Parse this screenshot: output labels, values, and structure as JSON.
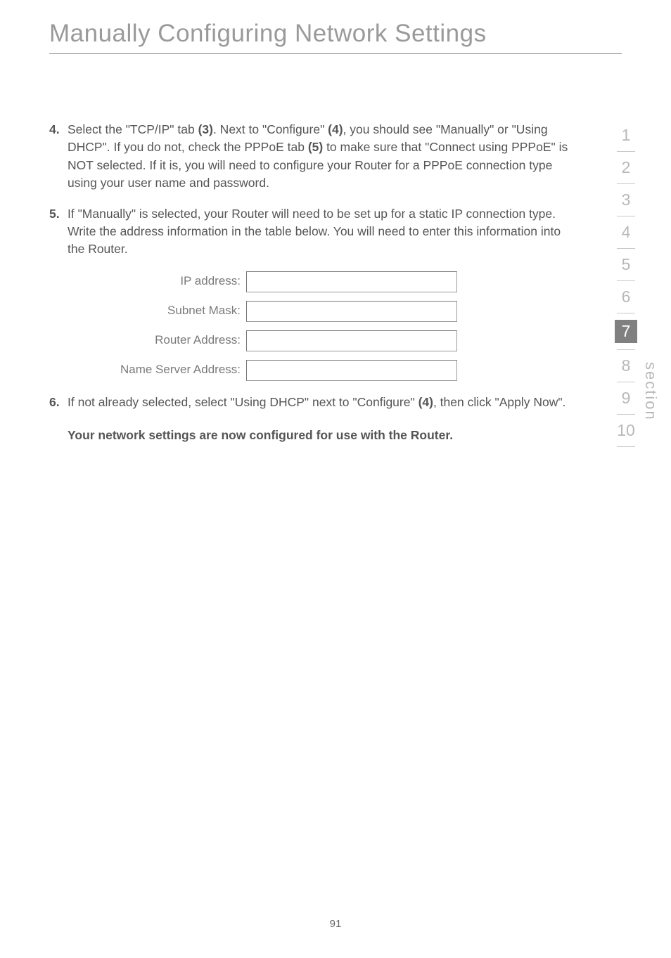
{
  "title": "Manually Configuring Network Settings",
  "steps": {
    "s4": {
      "num": "4.",
      "p1": "Select the \"TCP/IP\" tab ",
      "b1": "(3)",
      "p2": ". Next to \"Configure\" ",
      "b2": "(4)",
      "p3": ", you should see \"Manually\" or \"Using DHCP\". If you do not, check the PPPoE tab ",
      "b3": "(5)",
      "p4": " to make sure that \"Connect using PPPoE\" is NOT selected. If it is, you will need to configure your Router for a PPPoE connection type using your user name and password."
    },
    "s5": {
      "num": "5.",
      "text": "If \"Manually\" is selected, your Router will need to be set up for a static IP connection type. Write the address information in the table below. You will need to enter this information into the Router."
    },
    "s6": {
      "num": "6.",
      "p1": "If not already selected, select  \"Using DHCP\" next to \"Configure\" ",
      "b1": "(4)",
      "p2": ", then click \"Apply Now\"."
    }
  },
  "form": {
    "ip": "IP address:",
    "subnet": "Subnet Mask:",
    "router": "Router Address:",
    "dns": "Name Server Address:"
  },
  "conclusion": "Your network settings are now configured for use with the Router.",
  "sidebar": {
    "n1": "1",
    "n2": "2",
    "n3": "3",
    "n4": "4",
    "n5": "5",
    "n6": "6",
    "n7": "7",
    "n8": "8",
    "n9": "9",
    "n10": "10",
    "label": "section"
  },
  "page_num": "91"
}
